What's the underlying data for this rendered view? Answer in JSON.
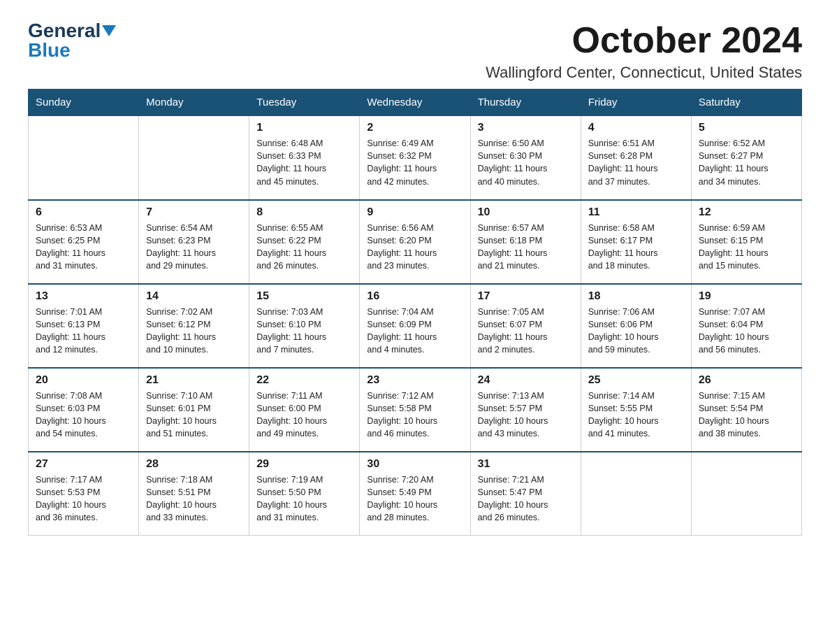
{
  "logo": {
    "general": "General",
    "blue": "Blue"
  },
  "title": "October 2024",
  "location": "Wallingford Center, Connecticut, United States",
  "days_of_week": [
    "Sunday",
    "Monday",
    "Tuesday",
    "Wednesday",
    "Thursday",
    "Friday",
    "Saturday"
  ],
  "weeks": [
    [
      {
        "day": "",
        "info": ""
      },
      {
        "day": "",
        "info": ""
      },
      {
        "day": "1",
        "info": "Sunrise: 6:48 AM\nSunset: 6:33 PM\nDaylight: 11 hours\nand 45 minutes."
      },
      {
        "day": "2",
        "info": "Sunrise: 6:49 AM\nSunset: 6:32 PM\nDaylight: 11 hours\nand 42 minutes."
      },
      {
        "day": "3",
        "info": "Sunrise: 6:50 AM\nSunset: 6:30 PM\nDaylight: 11 hours\nand 40 minutes."
      },
      {
        "day": "4",
        "info": "Sunrise: 6:51 AM\nSunset: 6:28 PM\nDaylight: 11 hours\nand 37 minutes."
      },
      {
        "day": "5",
        "info": "Sunrise: 6:52 AM\nSunset: 6:27 PM\nDaylight: 11 hours\nand 34 minutes."
      }
    ],
    [
      {
        "day": "6",
        "info": "Sunrise: 6:53 AM\nSunset: 6:25 PM\nDaylight: 11 hours\nand 31 minutes."
      },
      {
        "day": "7",
        "info": "Sunrise: 6:54 AM\nSunset: 6:23 PM\nDaylight: 11 hours\nand 29 minutes."
      },
      {
        "day": "8",
        "info": "Sunrise: 6:55 AM\nSunset: 6:22 PM\nDaylight: 11 hours\nand 26 minutes."
      },
      {
        "day": "9",
        "info": "Sunrise: 6:56 AM\nSunset: 6:20 PM\nDaylight: 11 hours\nand 23 minutes."
      },
      {
        "day": "10",
        "info": "Sunrise: 6:57 AM\nSunset: 6:18 PM\nDaylight: 11 hours\nand 21 minutes."
      },
      {
        "day": "11",
        "info": "Sunrise: 6:58 AM\nSunset: 6:17 PM\nDaylight: 11 hours\nand 18 minutes."
      },
      {
        "day": "12",
        "info": "Sunrise: 6:59 AM\nSunset: 6:15 PM\nDaylight: 11 hours\nand 15 minutes."
      }
    ],
    [
      {
        "day": "13",
        "info": "Sunrise: 7:01 AM\nSunset: 6:13 PM\nDaylight: 11 hours\nand 12 minutes."
      },
      {
        "day": "14",
        "info": "Sunrise: 7:02 AM\nSunset: 6:12 PM\nDaylight: 11 hours\nand 10 minutes."
      },
      {
        "day": "15",
        "info": "Sunrise: 7:03 AM\nSunset: 6:10 PM\nDaylight: 11 hours\nand 7 minutes."
      },
      {
        "day": "16",
        "info": "Sunrise: 7:04 AM\nSunset: 6:09 PM\nDaylight: 11 hours\nand 4 minutes."
      },
      {
        "day": "17",
        "info": "Sunrise: 7:05 AM\nSunset: 6:07 PM\nDaylight: 11 hours\nand 2 minutes."
      },
      {
        "day": "18",
        "info": "Sunrise: 7:06 AM\nSunset: 6:06 PM\nDaylight: 10 hours\nand 59 minutes."
      },
      {
        "day": "19",
        "info": "Sunrise: 7:07 AM\nSunset: 6:04 PM\nDaylight: 10 hours\nand 56 minutes."
      }
    ],
    [
      {
        "day": "20",
        "info": "Sunrise: 7:08 AM\nSunset: 6:03 PM\nDaylight: 10 hours\nand 54 minutes."
      },
      {
        "day": "21",
        "info": "Sunrise: 7:10 AM\nSunset: 6:01 PM\nDaylight: 10 hours\nand 51 minutes."
      },
      {
        "day": "22",
        "info": "Sunrise: 7:11 AM\nSunset: 6:00 PM\nDaylight: 10 hours\nand 49 minutes."
      },
      {
        "day": "23",
        "info": "Sunrise: 7:12 AM\nSunset: 5:58 PM\nDaylight: 10 hours\nand 46 minutes."
      },
      {
        "day": "24",
        "info": "Sunrise: 7:13 AM\nSunset: 5:57 PM\nDaylight: 10 hours\nand 43 minutes."
      },
      {
        "day": "25",
        "info": "Sunrise: 7:14 AM\nSunset: 5:55 PM\nDaylight: 10 hours\nand 41 minutes."
      },
      {
        "day": "26",
        "info": "Sunrise: 7:15 AM\nSunset: 5:54 PM\nDaylight: 10 hours\nand 38 minutes."
      }
    ],
    [
      {
        "day": "27",
        "info": "Sunrise: 7:17 AM\nSunset: 5:53 PM\nDaylight: 10 hours\nand 36 minutes."
      },
      {
        "day": "28",
        "info": "Sunrise: 7:18 AM\nSunset: 5:51 PM\nDaylight: 10 hours\nand 33 minutes."
      },
      {
        "day": "29",
        "info": "Sunrise: 7:19 AM\nSunset: 5:50 PM\nDaylight: 10 hours\nand 31 minutes."
      },
      {
        "day": "30",
        "info": "Sunrise: 7:20 AM\nSunset: 5:49 PM\nDaylight: 10 hours\nand 28 minutes."
      },
      {
        "day": "31",
        "info": "Sunrise: 7:21 AM\nSunset: 5:47 PM\nDaylight: 10 hours\nand 26 minutes."
      },
      {
        "day": "",
        "info": ""
      },
      {
        "day": "",
        "info": ""
      }
    ]
  ]
}
